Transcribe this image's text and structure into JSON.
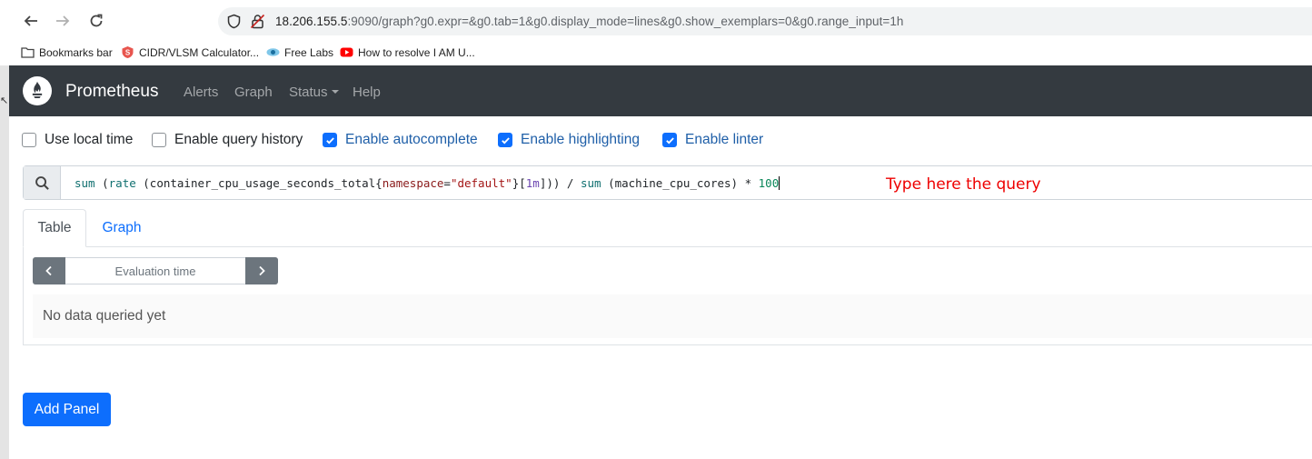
{
  "browser": {
    "url_host": "18.206.155.5",
    "url_rest": ":9090/graph?g0.expr=&g0.tab=1&g0.display_mode=lines&g0.show_exemplars=0&g0.range_input=1h",
    "bookmarks": [
      {
        "label": "Bookmarks bar",
        "icon": "folder-icon"
      },
      {
        "label": "CIDR/VLSM Calculator...",
        "icon": "subnet-s-icon"
      },
      {
        "label": "Free Labs",
        "icon": "eye-icon"
      },
      {
        "label": "How to resolve I AM U...",
        "icon": "youtube-icon"
      }
    ]
  },
  "navbar": {
    "brand": "Prometheus",
    "links": [
      "Alerts",
      "Graph",
      "Status",
      "Help"
    ]
  },
  "options": [
    {
      "label": "Use local time",
      "checked": false
    },
    {
      "label": "Enable query history",
      "checked": false
    },
    {
      "label": "Enable autocomplete",
      "checked": true
    },
    {
      "label": "Enable highlighting",
      "checked": true
    },
    {
      "label": "Enable linter",
      "checked": true
    }
  ],
  "query": {
    "tokens": {
      "sum1": "sum",
      "open1": " (",
      "rate": "rate",
      "open2": " (container_cpu_usage_seconds_total{",
      "label": "namespace",
      "eq": "=",
      "str": "\"default\"",
      "close_brace": "}[",
      "dur": "1m",
      "close1": "])) / ",
      "sum2": "sum",
      "mid": " (machine_cpu_cores) * ",
      "num": "100"
    },
    "annotation": "Type here the query"
  },
  "panel": {
    "tabs": [
      "Table",
      "Graph"
    ],
    "active_tab": "Table",
    "eval_placeholder": "Evaluation time",
    "empty_message": "No data queried yet"
  },
  "add_panel_label": "Add Panel",
  "colors": {
    "navbar": "#343a40",
    "primary": "#0d6efd",
    "annotation": "#e00000"
  }
}
